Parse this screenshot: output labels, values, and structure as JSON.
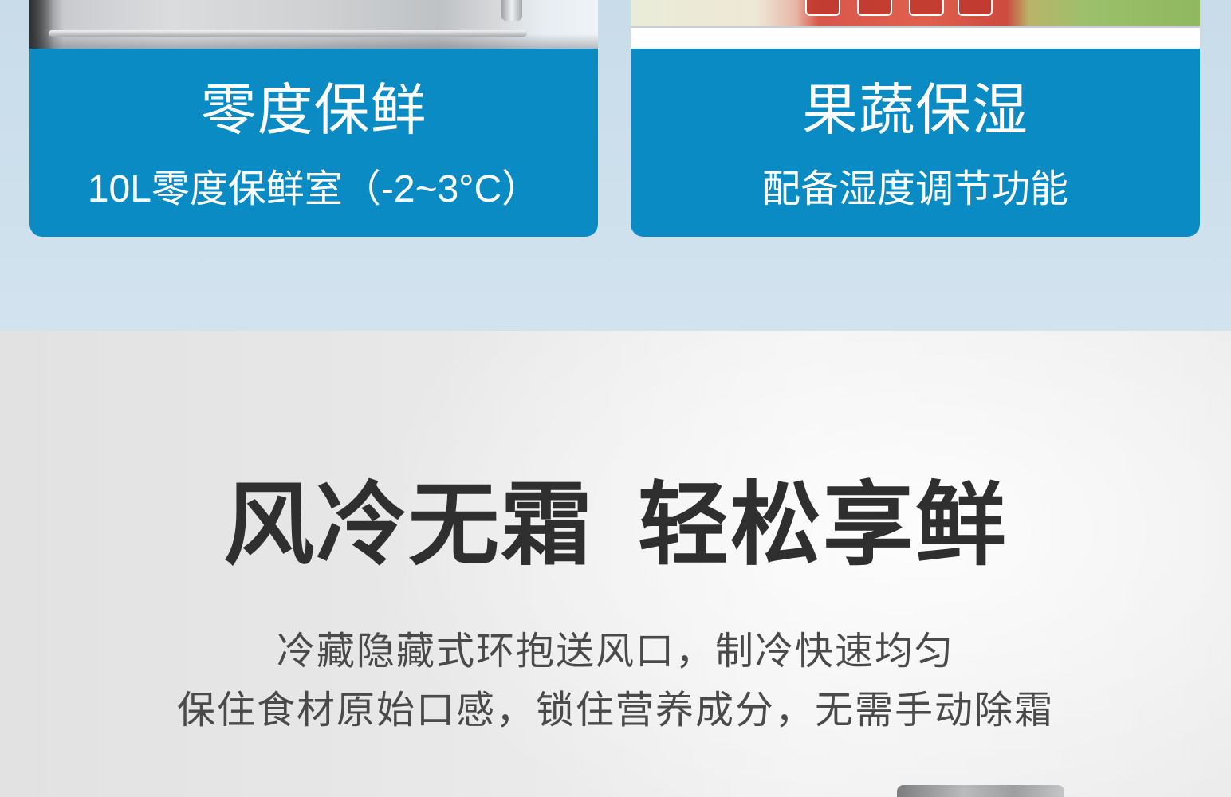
{
  "cards": [
    {
      "title": "零度保鲜",
      "subtitle": "10L零度保鲜室（-2~3°C）"
    },
    {
      "title": "果蔬保湿",
      "subtitle": "配备湿度调节功能"
    }
  ],
  "feature": {
    "heading": "风冷无霜 轻松享鲜",
    "lines": [
      "冷藏隐藏式环抱送风口，制冷快速均匀",
      "保住食材原始口感，锁住营养成分，无需手动除霜"
    ]
  },
  "colors": {
    "top_background": "#c9dcea",
    "card_blue": "#0b8bc4",
    "card_text": "#ffffff",
    "heading": "#2f2f2f",
    "body_text": "#4a4a4a"
  }
}
